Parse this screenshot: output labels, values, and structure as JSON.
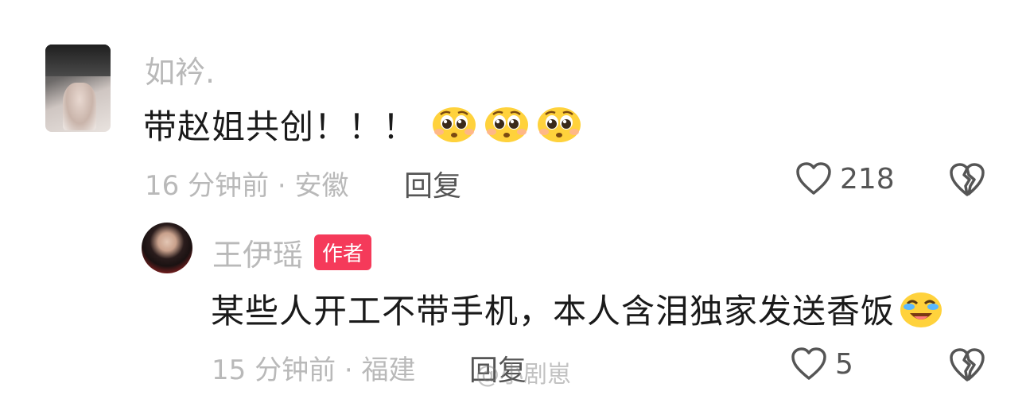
{
  "comment": {
    "username": "如衿.",
    "text": "带赵姐共创！！！",
    "emojis": [
      "pleading-face",
      "pleading-face",
      "pleading-face"
    ],
    "time": "16 分钟前",
    "location": "安徽",
    "reply_label": "回复",
    "likes": "218"
  },
  "reply": {
    "username": "王伊瑶",
    "badge": "作者",
    "text": "某些人开工不带手机，本人含泪独家发送香饭",
    "emoji": "laughing-crying-face",
    "time": "15 分钟前",
    "location": "福建",
    "reply_label": "回复",
    "likes": "5"
  },
  "watermark": "@小剧崽",
  "colors": {
    "muted": "#b9b9b9",
    "text": "#1a1a1a",
    "badge": "#f53a5a"
  }
}
